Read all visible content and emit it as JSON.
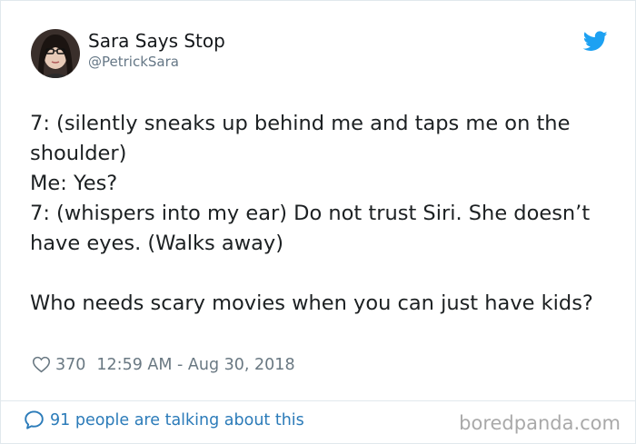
{
  "author": {
    "name": "Sara Says Stop",
    "handle": "@PetrickSara",
    "avatar_icon": "profile-photo",
    "platform_icon": "twitter-bird-icon",
    "brand_color": "#1da1f2"
  },
  "tweet": {
    "lines": [
      "7: (silently sneaks up behind me and taps me on the shoulder)",
      "Me: Yes?",
      "7: (whispers into my ear) Do not trust Siri. She doesn’t have eyes. (Walks away)"
    ],
    "closing": "Who needs scary movies when you can just have kids?"
  },
  "meta": {
    "likes": "370",
    "timestamp": "12:59 AM - Aug 30, 2018",
    "like_icon": "heart-icon"
  },
  "footer": {
    "talking_text": "91 people are talking about this",
    "talking_icon": "speech-bubble-icon",
    "link_color": "#2b7bb9"
  },
  "watermark": "boredpanda.com"
}
